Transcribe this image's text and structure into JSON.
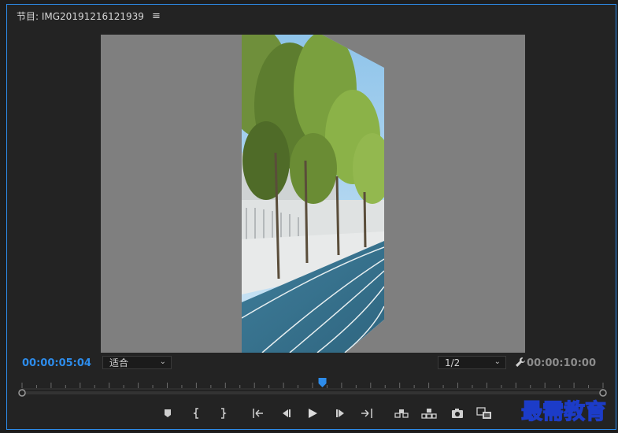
{
  "panel": {
    "title": "节目: IMG20191216121939",
    "menu_icon": "hamburger-menu-icon"
  },
  "timecode": {
    "current": "00:00:05:04",
    "duration": "00:00:10:00"
  },
  "fit_dropdown": {
    "value": "适合"
  },
  "resolution_dropdown": {
    "value": "1/2"
  },
  "playhead": {
    "position_fraction": 0.517
  },
  "controls": [
    {
      "name": "add-marker-button",
      "icon": "marker-icon"
    },
    {
      "name": "mark-in-button",
      "icon": "mark-in-icon"
    },
    {
      "name": "mark-out-button",
      "icon": "mark-out-icon"
    },
    {
      "name": "go-to-in-button",
      "icon": "go-to-in-icon"
    },
    {
      "name": "step-back-button",
      "icon": "step-back-icon"
    },
    {
      "name": "play-button",
      "icon": "play-icon"
    },
    {
      "name": "step-forward-button",
      "icon": "step-forward-icon"
    },
    {
      "name": "go-to-out-button",
      "icon": "go-to-out-icon"
    },
    {
      "name": "lift-button",
      "icon": "lift-icon"
    },
    {
      "name": "extract-button",
      "icon": "extract-icon"
    },
    {
      "name": "export-frame-button",
      "icon": "camera-icon"
    },
    {
      "name": "compare-view-button",
      "icon": "compare-icon"
    }
  ],
  "watermark": {
    "text": "最需教育"
  },
  "colors": {
    "accent": "#2d8ceb",
    "panel_bg": "#232323",
    "viewer_bg": "#7f7f7f"
  }
}
